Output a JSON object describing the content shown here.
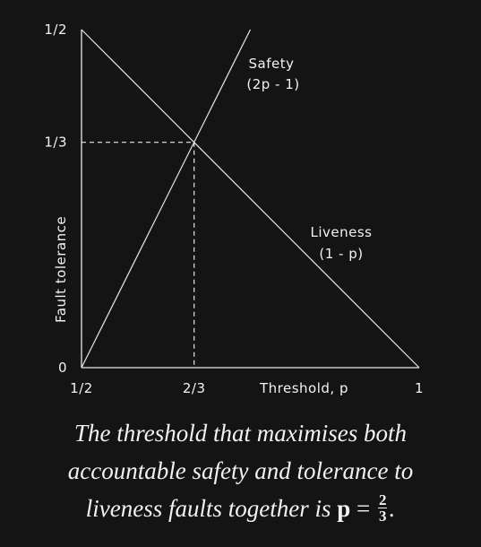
{
  "chart_data": {
    "type": "line",
    "xlabel": "Threshold, p",
    "ylabel": "Fault tolerance",
    "xlim": [
      0.5,
      1
    ],
    "ylim": [
      0,
      0.5
    ],
    "x_ticks": [
      {
        "value": 0.5,
        "label": "1/2"
      },
      {
        "value": 0.6667,
        "label": "2/3"
      },
      {
        "value": 1,
        "label": "1"
      }
    ],
    "y_ticks": [
      {
        "value": 0,
        "label": "0"
      },
      {
        "value": 0.3333,
        "label": "1/3"
      },
      {
        "value": 0.5,
        "label": "1/2"
      }
    ],
    "series": [
      {
        "name": "Safety",
        "formula": "(2p - 1)",
        "x": [
          0.5,
          0.75
        ],
        "y": [
          0,
          0.5
        ]
      },
      {
        "name": "Liveness",
        "formula": "(1 - p)",
        "x": [
          0.5,
          1
        ],
        "y": [
          0.5,
          0
        ]
      }
    ],
    "intersection": {
      "x": 0.6667,
      "y": 0.3333
    },
    "grid": false
  },
  "caption": {
    "line1": "The threshold that maximises both",
    "line2": "accountable safety and tolerance to",
    "line3_text": "liveness faults together is",
    "math_var": "p",
    "math_eq": "=",
    "frac_num": "2",
    "frac_den": "3",
    "end_punct": "."
  }
}
